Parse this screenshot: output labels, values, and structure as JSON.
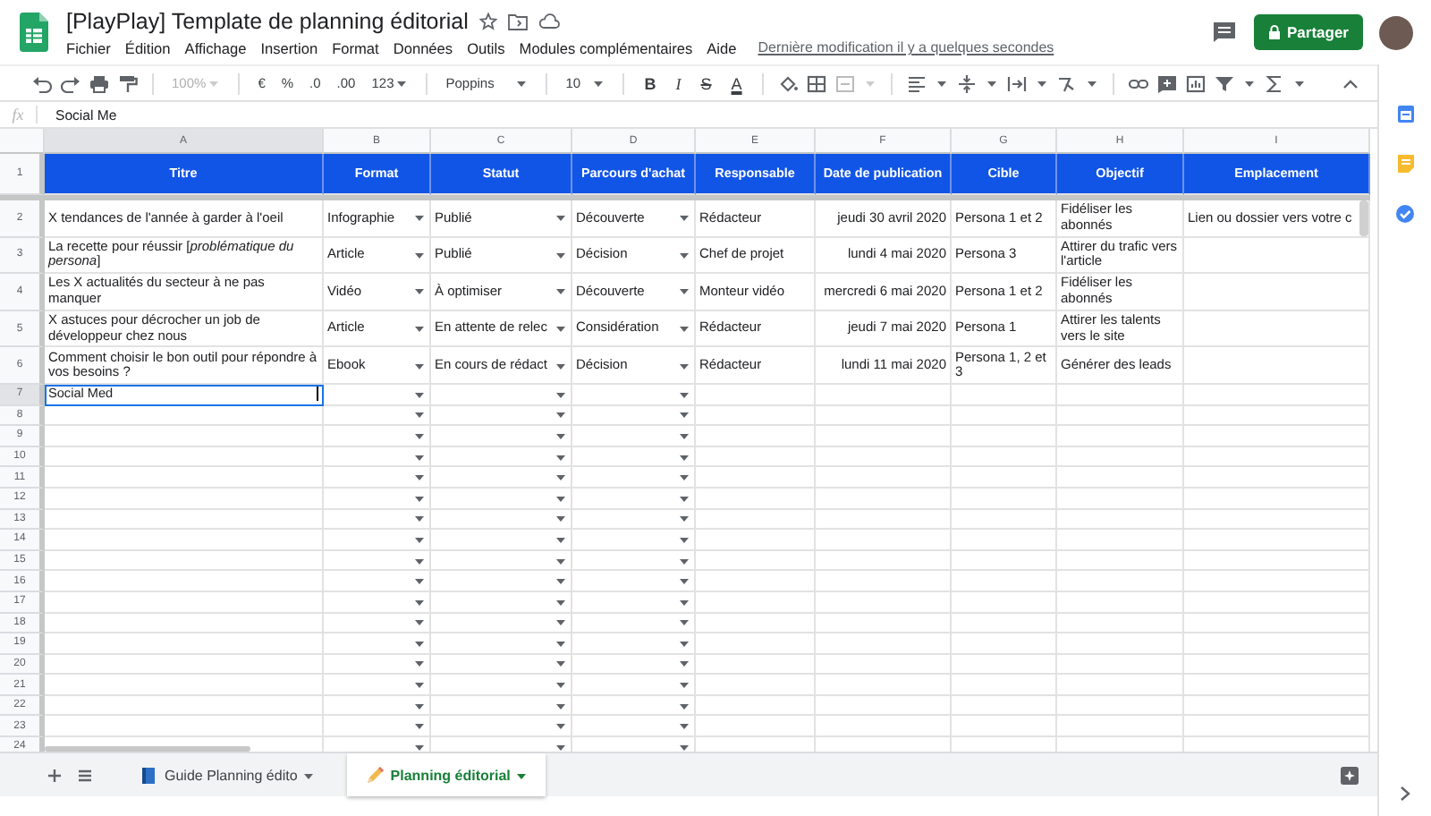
{
  "document": {
    "title": "[PlayPlay] Template de planning éditorial",
    "last_modified": "Dernière modification il y a quelques secondes"
  },
  "menu": [
    "Fichier",
    "Édition",
    "Affichage",
    "Insertion",
    "Format",
    "Données",
    "Outils",
    "Modules complémentaires",
    "Aide"
  ],
  "share_button": {
    "label": "Partager"
  },
  "toolbar": {
    "zoom": "100%",
    "zoom_disabled": true,
    "number_formats": [
      "€",
      "%",
      ".0",
      ".00",
      "123"
    ],
    "font": "Poppins",
    "font_size": "10",
    "text_styles": [
      "B",
      "I",
      "S",
      "A"
    ]
  },
  "formula_bar": {
    "label": "fx",
    "value": "Social Me"
  },
  "table": {
    "header_row_number": "1",
    "columns": [
      {
        "letter": "A",
        "title": "Titre",
        "kind": "text"
      },
      {
        "letter": "B",
        "title": "Format",
        "kind": "choice"
      },
      {
        "letter": "C",
        "title": "Statut",
        "kind": "choice"
      },
      {
        "letter": "D",
        "title": "Parcours d'achat",
        "kind": "choice"
      },
      {
        "letter": "E",
        "title": "Responsable",
        "kind": "text"
      },
      {
        "letter": "F",
        "title": "Date de publication",
        "kind": "date"
      },
      {
        "letter": "G",
        "title": "Cible",
        "kind": "text"
      },
      {
        "letter": "H",
        "title": "Objectif",
        "kind": "text"
      },
      {
        "letter": "I",
        "title": "Emplacement",
        "kind": "text"
      }
    ],
    "rows": [
      {
        "number": "2",
        "editing": false,
        "cells": [
          "X tendances de l'année à garder à l'oeil",
          "Infographie",
          "Publié",
          "Découverte",
          "Rédacteur",
          "jeudi 30 avril 2020",
          "Persona 1 et 2",
          "Fidéliser les abonnés",
          "Lien ou dossier vers votre c"
        ]
      },
      {
        "number": "3",
        "editing": false,
        "cells": [
          "La recette pour réussir [*problématique du persona*]",
          "Article",
          "Publié",
          "Décision",
          "Chef de projet",
          "lundi 4 mai 2020",
          "Persona 3",
          "Attirer du trafic vers l'article"
        ]
      },
      {
        "number": "4",
        "editing": false,
        "cells": [
          "Les X actualités du secteur à ne pas manquer",
          "Vidéo",
          "À optimiser",
          "Découverte",
          "Monteur vidéo",
          "mercredi 6 mai 2020",
          "Persona 1 et 2",
          "Fidéliser les abonnés"
        ]
      },
      {
        "number": "5",
        "editing": false,
        "cells": [
          "X astuces pour décrocher un job de développeur chez nous",
          "Article",
          "En attente de relec",
          "Considération",
          "Rédacteur",
          "jeudi 7 mai 2020",
          "Persona 1",
          "Attirer les talents vers le site"
        ]
      },
      {
        "number": "6",
        "editing": false,
        "cells": [
          "Comment choisir le bon outil pour répondre à vos besoins ?",
          "Ebook",
          "En cours de rédact",
          "Décision",
          "Rédacteur",
          "lundi 11 mai 2020",
          "Persona 1, 2 et 3",
          "Générer des leads"
        ]
      },
      {
        "number": "7",
        "editing": true,
        "cells": [
          "Social Med"
        ]
      },
      {
        "number": "8",
        "editing": false,
        "cells": []
      },
      {
        "number": "9",
        "editing": false,
        "cells": []
      },
      {
        "number": "10",
        "editing": false,
        "cells": []
      },
      {
        "number": "11",
        "editing": false,
        "cells": []
      },
      {
        "number": "12",
        "editing": false,
        "cells": []
      },
      {
        "number": "13",
        "editing": false,
        "cells": []
      },
      {
        "number": "14",
        "editing": false,
        "cells": []
      },
      {
        "number": "15",
        "editing": false,
        "cells": []
      },
      {
        "number": "16",
        "editing": false,
        "cells": []
      },
      {
        "number": "17",
        "editing": false,
        "cells": []
      },
      {
        "number": "18",
        "editing": false,
        "cells": []
      },
      {
        "number": "19",
        "editing": false,
        "cells": []
      },
      {
        "number": "20",
        "editing": false,
        "cells": []
      },
      {
        "number": "21",
        "editing": false,
        "cells": []
      },
      {
        "number": "22",
        "editing": false,
        "cells": []
      },
      {
        "number": "23",
        "editing": false,
        "cells": []
      },
      {
        "number": "24",
        "editing": false,
        "cells": []
      }
    ]
  },
  "sheet_tabs": [
    {
      "label": "Guide Planning édito",
      "selected": false
    },
    {
      "label": "Planning éditorial",
      "selected": true
    }
  ]
}
